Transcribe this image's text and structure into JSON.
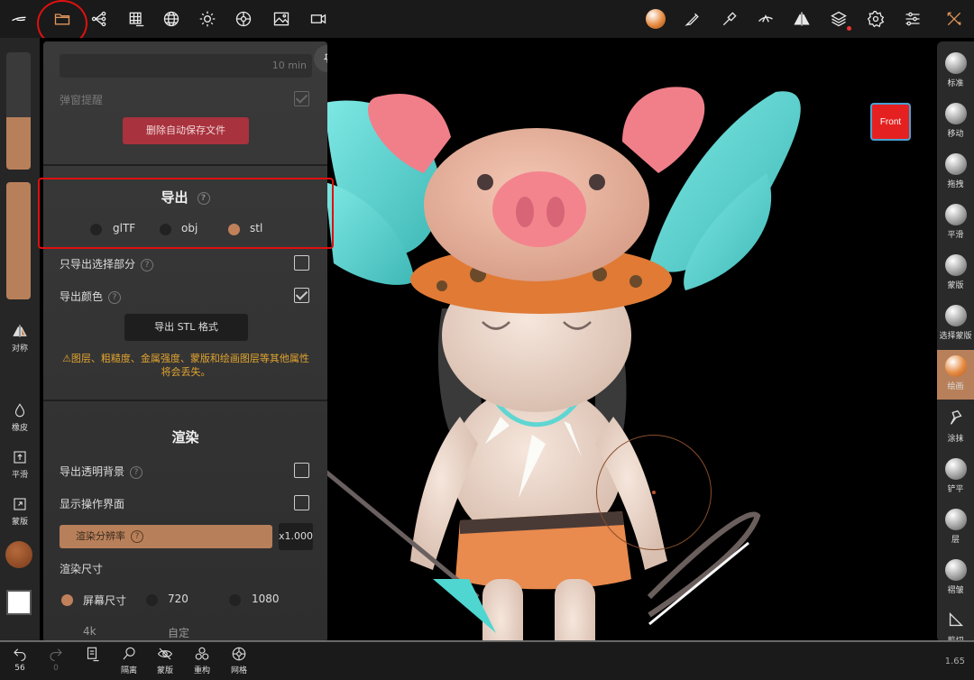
{
  "topbar": {
    "icons": [
      "brush-stroke-icon",
      "folder-icon",
      "scene-graph-icon",
      "topology-grid-icon",
      "sphere-mesh-icon",
      "light-icon",
      "material-ball-icon",
      "background-image-icon",
      "camera-icon",
      "matcap-ball-icon",
      "brush-icon",
      "picker-icon",
      "stroke-icon",
      "symmetry-icon",
      "layers-icon",
      "settings-icon",
      "sliders-icon",
      "tools-icon"
    ],
    "accent_color": "#e0955a"
  },
  "viewport": {
    "front_label": "Front",
    "front_color": "#e52020"
  },
  "leftbar": {
    "slider_top_level": 0.45,
    "slider_bottom_level": 1.0,
    "symmetry_label": "对称",
    "eraser_label": "橡皮",
    "smooth_label": "平滑",
    "mask_label": "蒙版"
  },
  "panel": {
    "autosave_interval": "10 min",
    "popup_reminder_label": "弹窗提醒",
    "delete_autosave_label": "删除自动保存文件",
    "export_title": "导出",
    "export_formats": [
      "glTF",
      "obj",
      "stl"
    ],
    "export_selected_format": "stl",
    "export_selected_only_label": "只导出选择部分",
    "export_color_label": "导出颜色",
    "export_button_label": "导出 STL 格式",
    "warning_text": "⚠图层、粗糙度、金属强度、蒙版和绘画图层等其他属性将会丢失。",
    "render_title": "渲染",
    "transparent_bg_label": "导出透明背景",
    "show_ui_label": "显示操作界面",
    "render_resolution_label": "渲染分辨率",
    "render_resolution_value": "x1.000",
    "render_size_label": "渲染尺寸",
    "render_sizes": [
      "屏幕尺寸",
      "720",
      "1080"
    ],
    "render_sizes_row2": [
      "4k",
      "自定"
    ],
    "help_mark": "?"
  },
  "rightbar": {
    "tools": [
      {
        "label": "标准",
        "icon": "standard-brush-icon"
      },
      {
        "label": "移动",
        "icon": "move-brush-icon"
      },
      {
        "label": "拖拽",
        "icon": "drag-brush-icon"
      },
      {
        "label": "平滑",
        "icon": "smooth-brush-icon"
      },
      {
        "label": "蒙版",
        "icon": "mask-brush-icon"
      },
      {
        "label": "选择蒙版",
        "icon": "select-mask-icon"
      },
      {
        "label": "绘画",
        "icon": "paint-brush-icon"
      },
      {
        "label": "涂抹",
        "icon": "smudge-icon"
      },
      {
        "label": "铲平",
        "icon": "flatten-icon"
      },
      {
        "label": "层",
        "icon": "layer-brush-icon"
      },
      {
        "label": "褶皱",
        "icon": "crease-icon"
      },
      {
        "label": "剪切",
        "icon": "trim-icon"
      }
    ],
    "active_tool": "绘画",
    "active_color": "#b8805a"
  },
  "bottombar": {
    "undo_count": "56",
    "redo_count": "0",
    "isolate_label": "隔离",
    "mask_label": "蒙版",
    "remesh_label": "重构",
    "mesh_label": "网格",
    "version_number": "1.65"
  }
}
